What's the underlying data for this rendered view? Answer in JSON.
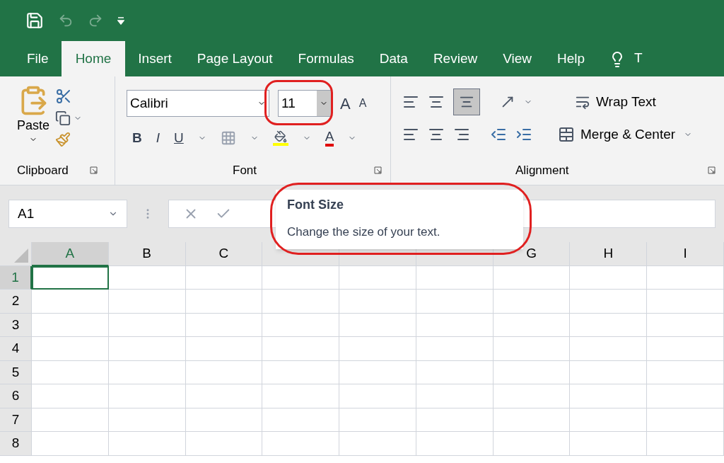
{
  "tabs": [
    {
      "label": "File",
      "selected": false
    },
    {
      "label": "Home",
      "selected": true
    },
    {
      "label": "Insert",
      "selected": false
    },
    {
      "label": "Page Layout",
      "selected": false
    },
    {
      "label": "Formulas",
      "selected": false
    },
    {
      "label": "Data",
      "selected": false
    },
    {
      "label": "Review",
      "selected": false
    },
    {
      "label": "View",
      "selected": false
    },
    {
      "label": "Help",
      "selected": false
    }
  ],
  "tell_me": "T",
  "clipboard": {
    "paste": "Paste",
    "group": "Clipboard"
  },
  "font": {
    "name": "Calibri",
    "size": "11",
    "grow": "A",
    "shrink": "A",
    "bold": "B",
    "italic": "I",
    "underline": "U",
    "font_color_letter": "A",
    "group": "Font",
    "size_highlighted": true
  },
  "alignment": {
    "wrap": "Wrap Text",
    "merge": "Merge & Center",
    "group": "Alignment",
    "bottom_align_selected": true
  },
  "name_box": "A1",
  "tooltip": {
    "title": "Font Size",
    "text": "Change the size of your text.",
    "highlighted": true
  },
  "columns": [
    {
      "label": "A",
      "selected": true
    },
    {
      "label": "B",
      "selected": false
    },
    {
      "label": "C",
      "selected": false
    },
    {
      "selected": false
    },
    {
      "selected": false
    },
    {
      "selected": false
    },
    {
      "label": "G",
      "selected": false
    },
    {
      "label": "H",
      "selected": false
    },
    {
      "label": "I",
      "selected": false
    }
  ],
  "rows": [
    {
      "label": "1",
      "selected": true
    },
    {
      "label": "2",
      "selected": false
    },
    {
      "label": "3",
      "selected": false
    },
    {
      "label": "4",
      "selected": false
    },
    {
      "label": "5",
      "selected": false
    },
    {
      "label": "6",
      "selected": false
    },
    {
      "label": "7",
      "selected": false
    },
    {
      "label": "8",
      "selected": false
    }
  ]
}
